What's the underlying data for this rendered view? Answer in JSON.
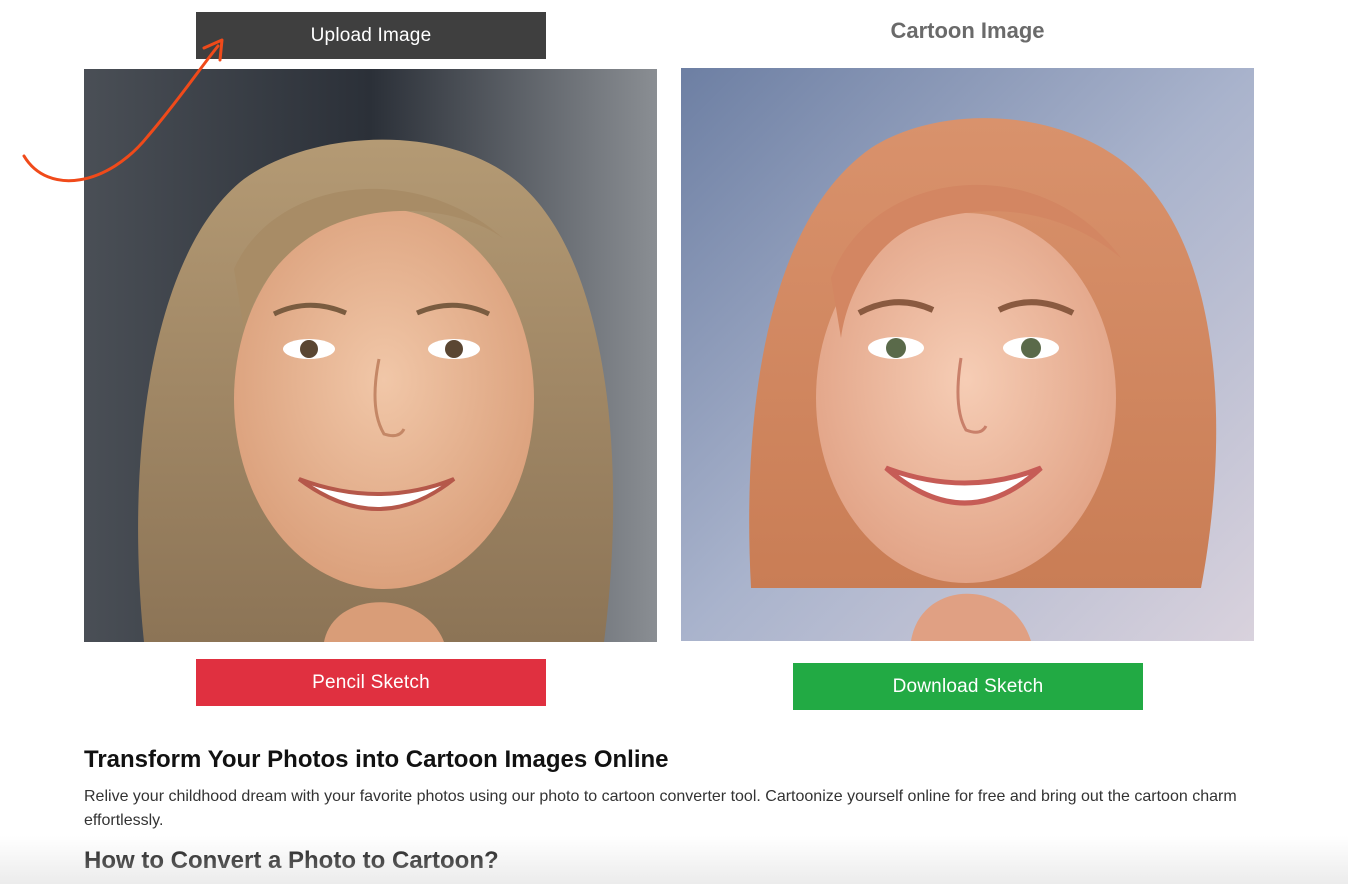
{
  "upload_button": {
    "label": "Upload Image"
  },
  "cartoon_column": {
    "title": "Cartoon Image"
  },
  "pencil_button": {
    "label": "Pencil Sketch"
  },
  "download_button": {
    "label": "Download Sketch"
  },
  "content": {
    "heading_transform": "Transform Your Photos into Cartoon Images Online",
    "intro_paragraph": "Relive your childhood dream with your favorite photos using our photo to cartoon converter tool. Cartoonize yourself online for free and bring out the cartoon charm effortlessly.",
    "heading_howto": "How to Convert a Photo to Cartoon?"
  },
  "images": {
    "original": "woman-portrait-photo",
    "cartoon": "woman-portrait-cartoon"
  },
  "colors": {
    "upload_button": "#3f3f3f",
    "pencil_button": "#e03040",
    "download_button": "#22aa44",
    "arrow": "#f04a1a"
  },
  "icons": {
    "arrow": "curved-arrow-icon"
  }
}
